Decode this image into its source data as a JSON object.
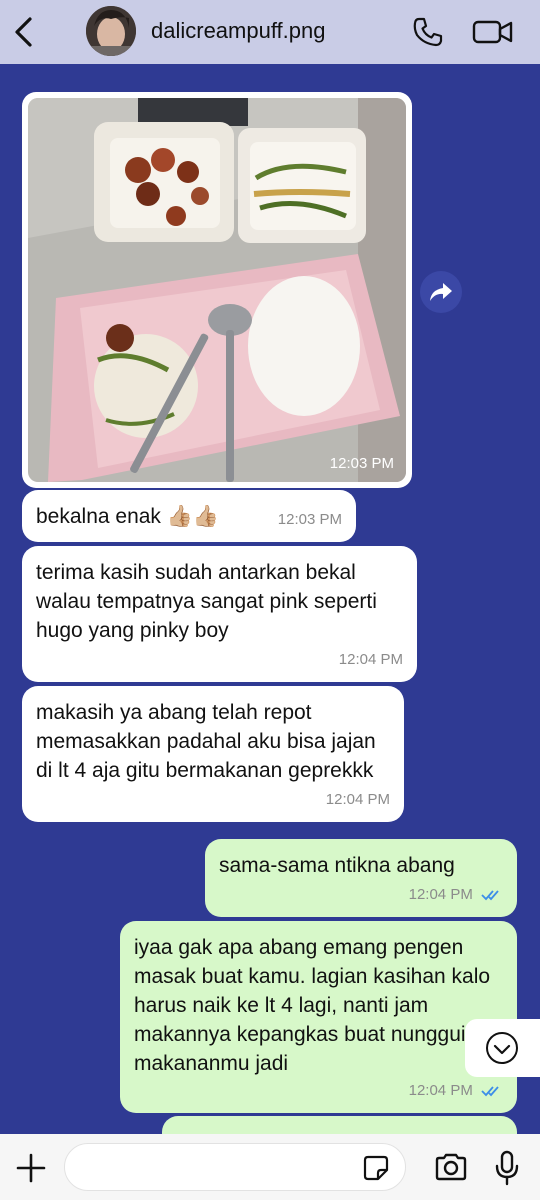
{
  "header": {
    "contact_name": "dalicreampuff.png",
    "back_icon": "chevron-left-icon",
    "call_icon": "phone-icon",
    "video_icon": "video-camera-icon"
  },
  "colors": {
    "header_bg": "#c9cce6",
    "chat_bg": "#2f3a93",
    "incoming_bubble": "#ffffff",
    "outgoing_bubble": "#d7f8c9",
    "read_ticks": "#3d8ee8"
  },
  "messages": [
    {
      "type": "image",
      "direction": "in",
      "time": "12:03 PM"
    },
    {
      "type": "text",
      "direction": "in",
      "text": "bekalna enak 👍🏼👍🏼",
      "time": "12:03 PM"
    },
    {
      "type": "text",
      "direction": "in",
      "text": "terima kasih sudah antarkan bekal walau tempatnya sangat pink seperti hugo yang pinky boy",
      "time": "12:04 PM"
    },
    {
      "type": "text",
      "direction": "in",
      "text": "makasih ya abang telah repot memasakkan padahal aku bisa jajan di lt 4 aja gitu bermakanan geprekkk",
      "time": "12:04 PM"
    },
    {
      "type": "text",
      "direction": "out",
      "text": "sama-sama ntikna abang",
      "time": "12:04 PM",
      "read": true
    },
    {
      "type": "text",
      "direction": "out",
      "text": "iyaa gak apa abang emang pengen masak buat kamu. lagian kasihan kalo harus naik ke lt 4 lagi, nanti jam makannya kepangkas buat nungguin makananmu jadi",
      "time": "12:04 PM",
      "read": true
    }
  ],
  "composer": {
    "placeholder": "",
    "value": ""
  }
}
